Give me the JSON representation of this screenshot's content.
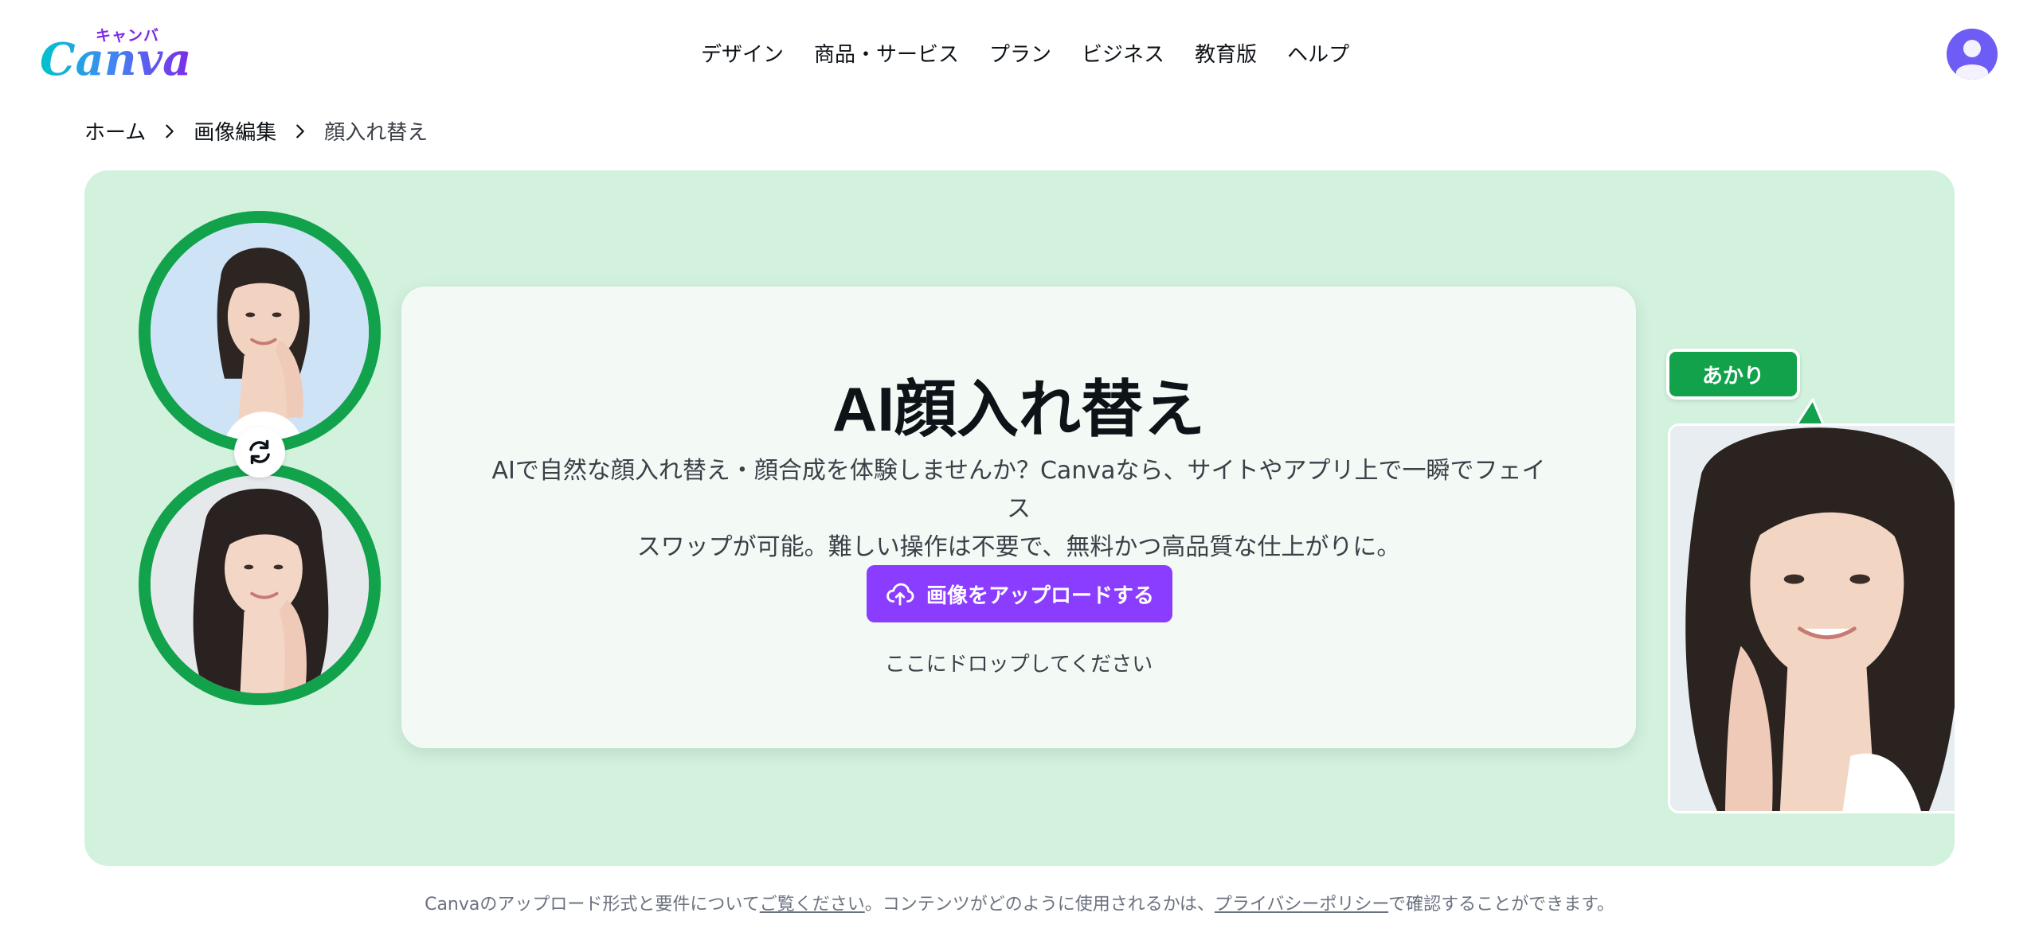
{
  "header": {
    "logo_kana": "キャンバ",
    "logo_word": "Canva",
    "nav": [
      "デザイン",
      "商品・サービス",
      "プラン",
      "ビジネス",
      "教育版",
      "ヘルプ"
    ],
    "avatar_icon": "user-avatar-icon"
  },
  "breadcrumb": {
    "items": [
      "ホーム",
      "画像編集",
      "顔入れ替え"
    ],
    "separator_icon": "chevron-right-icon"
  },
  "hero": {
    "title": "AI顔入れ替え",
    "description_line1": "AIで自然な顔入れ替え・顔合成を体験しませんか？Canvaなら、サイトやアプリ上で一瞬でフェイス",
    "description_line2": "スワップが可能。難しい操作は不要で、無料かつ高品質な仕上がりに。",
    "upload_button": "画像をアップロードする",
    "upload_icon": "cloud-upload-icon",
    "drop_hint": "ここにドロップしてください",
    "name_tag": "あかり",
    "swap_icon": "swap-arrows-icon"
  },
  "footer": {
    "part1": "Canvaのアップロード形式と要件について",
    "link1": "ご覧ください",
    "part2": "。コンテンツがどのように使用されるかは、",
    "link2": "プライバシーポリシー",
    "part3": "で確認することができます。"
  },
  "colors": {
    "hero_bg": "#d2f2de",
    "accent_green": "#12a24c",
    "upload_purple": "#8b3dff",
    "avatar_purple": "#6e5df4"
  }
}
